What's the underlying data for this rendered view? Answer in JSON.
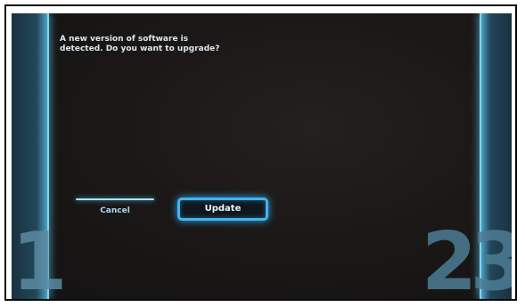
{
  "dialog": {
    "message_line1": "A new version of software is",
    "message_line2": "detected. Do you want to upgrade?"
  },
  "buttons": {
    "cancel_label": "Cancel",
    "update_label": "Update"
  },
  "steps": {
    "left": "1",
    "right": "23"
  },
  "colors": {
    "screen_bg": "#1b1817",
    "accent_glow": "#3fb6f0",
    "side_panel": "#22465a"
  }
}
